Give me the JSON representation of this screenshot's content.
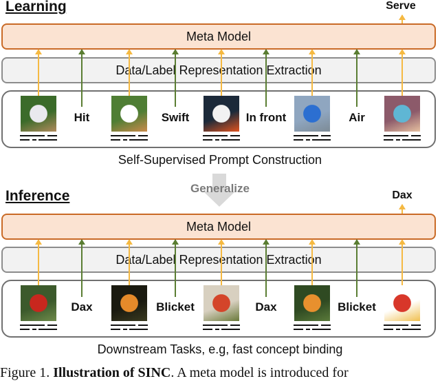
{
  "learning": {
    "section_title": "Learning",
    "output_label": "Serve",
    "meta_model_label": "Meta Model",
    "extraction_label": "Data/Label Representation Extraction",
    "prompt_caption": "Self-Supervised Prompt Construction",
    "items": [
      {
        "type": "image",
        "name": "baseball-batter-image",
        "colors": [
          "#3b6b2a",
          "#e9e9ee",
          "#b08a5c"
        ]
      },
      {
        "type": "word",
        "text": "Hit"
      },
      {
        "type": "image",
        "name": "running-dog-image",
        "colors": [
          "#4f7e34",
          "#ffffff",
          "#c98a4a"
        ]
      },
      {
        "type": "word",
        "text": "Swift"
      },
      {
        "type": "image",
        "name": "dog-and-parrot-image",
        "colors": [
          "#1c2a3a",
          "#f2f2f2",
          "#e0531f"
        ]
      },
      {
        "type": "word",
        "text": "In front"
      },
      {
        "type": "image",
        "name": "snowboarder-image",
        "colors": [
          "#8fa6c0",
          "#2c6fd1",
          "#7d8b96"
        ]
      },
      {
        "type": "word",
        "text": "Air"
      },
      {
        "type": "image",
        "name": "tennis-player-image",
        "colors": [
          "#8c5a6a",
          "#5fb6d4",
          "#e6c0a0"
        ]
      }
    ]
  },
  "generalize": {
    "label": "Generalize",
    "arrow_color": "#d9d9d9",
    "text_color": "#7a7a7a"
  },
  "inference": {
    "section_title": "Inference",
    "output_label": "Dax",
    "meta_model_label": "Meta Model",
    "extraction_label": "Data/Label Representation Extraction",
    "prompt_caption": "Downstream Tasks, e.g, fast concept binding",
    "items": [
      {
        "type": "image",
        "name": "red-apple-tree-image",
        "colors": [
          "#3c5a2c",
          "#c8271e",
          "#6e8a4a"
        ]
      },
      {
        "type": "word",
        "text": "Dax"
      },
      {
        "type": "image",
        "name": "orange-fruit-image",
        "colors": [
          "#1a1a10",
          "#e58a2a",
          "#3a3a20"
        ]
      },
      {
        "type": "word",
        "text": "Blicket"
      },
      {
        "type": "image",
        "name": "apple-branch-image",
        "colors": [
          "#d8d0c0",
          "#d4452a",
          "#6a7a3a"
        ]
      },
      {
        "type": "word",
        "text": "Dax"
      },
      {
        "type": "image",
        "name": "orange-tree-image",
        "colors": [
          "#2f4a22",
          "#e8902e",
          "#5a7a3a"
        ]
      },
      {
        "type": "word",
        "text": "Blicket"
      },
      {
        "type": "image",
        "name": "single-apple-image",
        "colors": [
          "#ffffff",
          "#d8372a",
          "#f0c050"
        ]
      }
    ]
  },
  "colors": {
    "meta_border": "#c96a26",
    "meta_fill": "#fbe3d2",
    "extract_border": "#8c8c8c",
    "extract_fill": "#f2f2f2",
    "data_arrow": "#f5b942",
    "label_arrow": "#5a7d32"
  },
  "figure_caption": {
    "prefix": "Figure 1. ",
    "bold": "Illustration of SINC",
    "rest": ". A meta model is introduced for"
  }
}
